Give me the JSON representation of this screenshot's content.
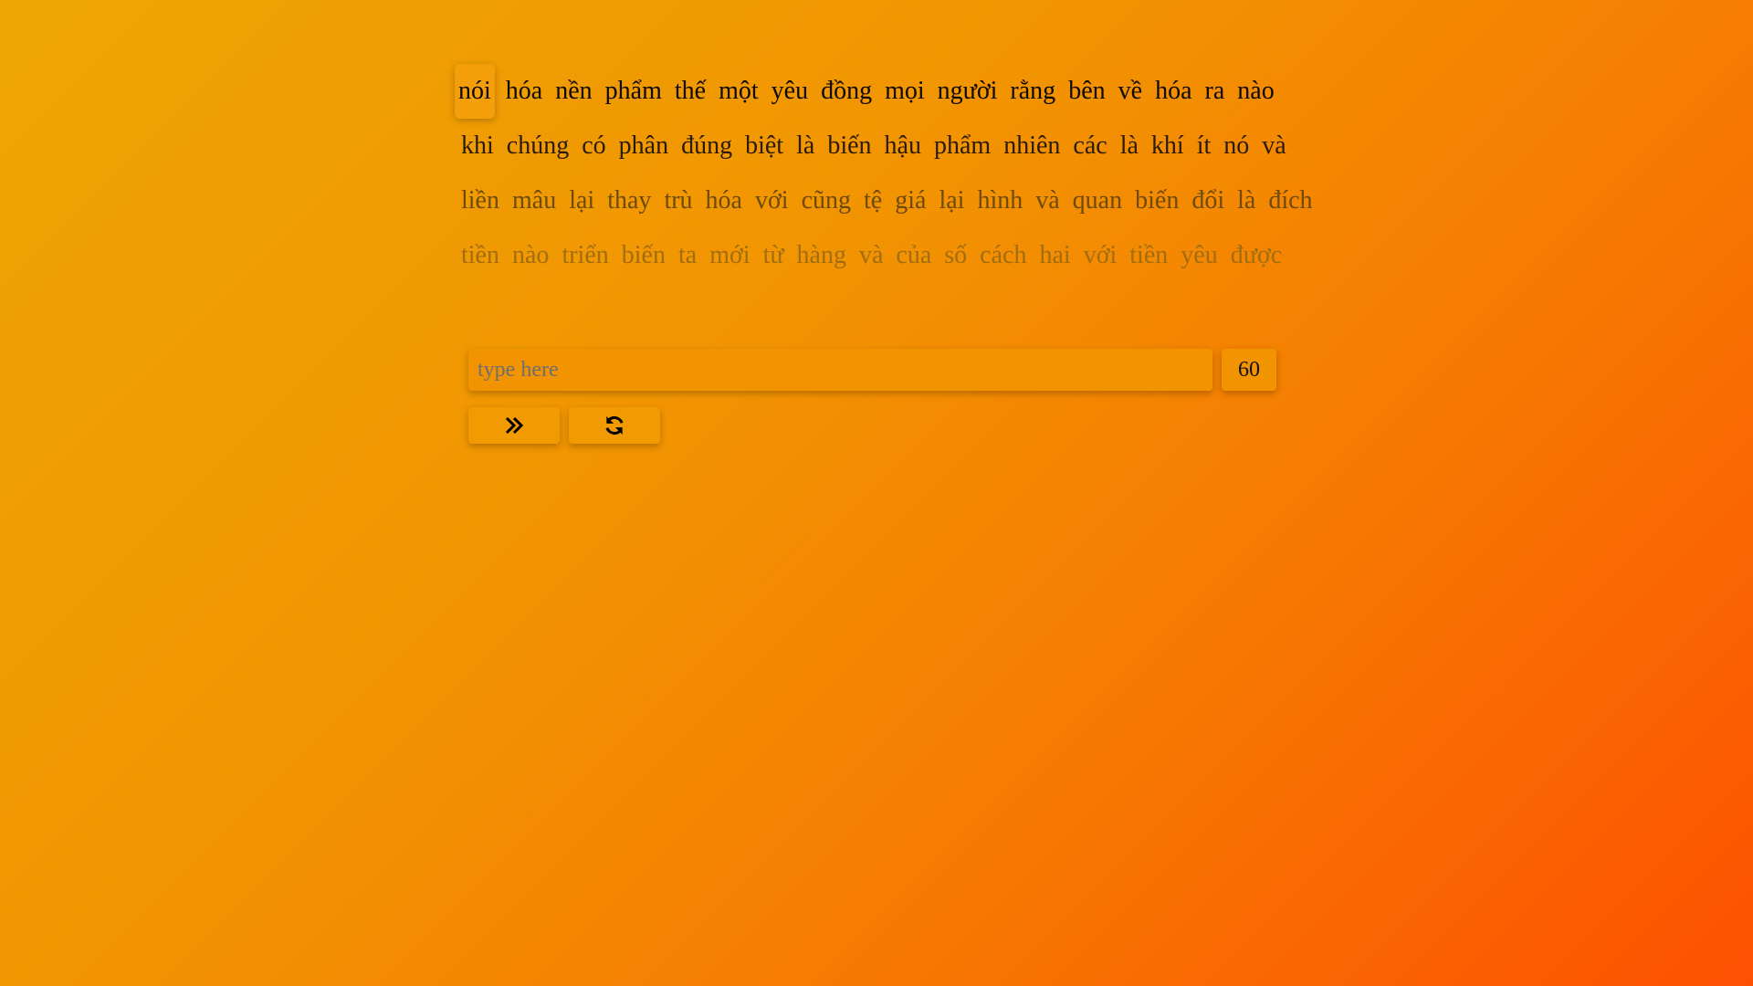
{
  "words": {
    "lines": [
      [
        "nói",
        "hóa",
        "nền",
        "phẩm",
        "thế",
        "một",
        "yêu",
        "đồng",
        "mọi",
        "người",
        "rằng",
        "bên",
        "về",
        "hóa",
        "ra",
        "nào"
      ],
      [
        "khi",
        "chúng",
        "có",
        "phân",
        "đúng",
        "biệt",
        "là",
        "biến",
        "hậu",
        "phẩm",
        "nhiên",
        "các",
        "là",
        "khí",
        "ít",
        "nó",
        "và"
      ],
      [
        "liền",
        "mâu",
        "lại",
        "thay",
        "trù",
        "hóa",
        "với",
        "cũng",
        "tệ",
        "giá",
        "lại",
        "hình",
        "và",
        "quan",
        "biến",
        "đổi",
        "là",
        "đích"
      ],
      [
        "tiền",
        "nào",
        "triển",
        "biến",
        "ta",
        "mới",
        "từ",
        "hàng",
        "và",
        "của",
        "số",
        "cách",
        "hai",
        "với",
        "tiền",
        "yêu",
        "được"
      ]
    ],
    "current_word": "nói"
  },
  "input": {
    "placeholder": "type here",
    "value": ""
  },
  "timer": {
    "seconds": "60"
  },
  "buttons": {
    "next_icon": "double-chevron-right-icon",
    "restart_icon": "refresh-icon"
  },
  "colors": {
    "gradient_start": "#eda605",
    "gradient_end": "#fd5102",
    "panel": "#f29402"
  }
}
